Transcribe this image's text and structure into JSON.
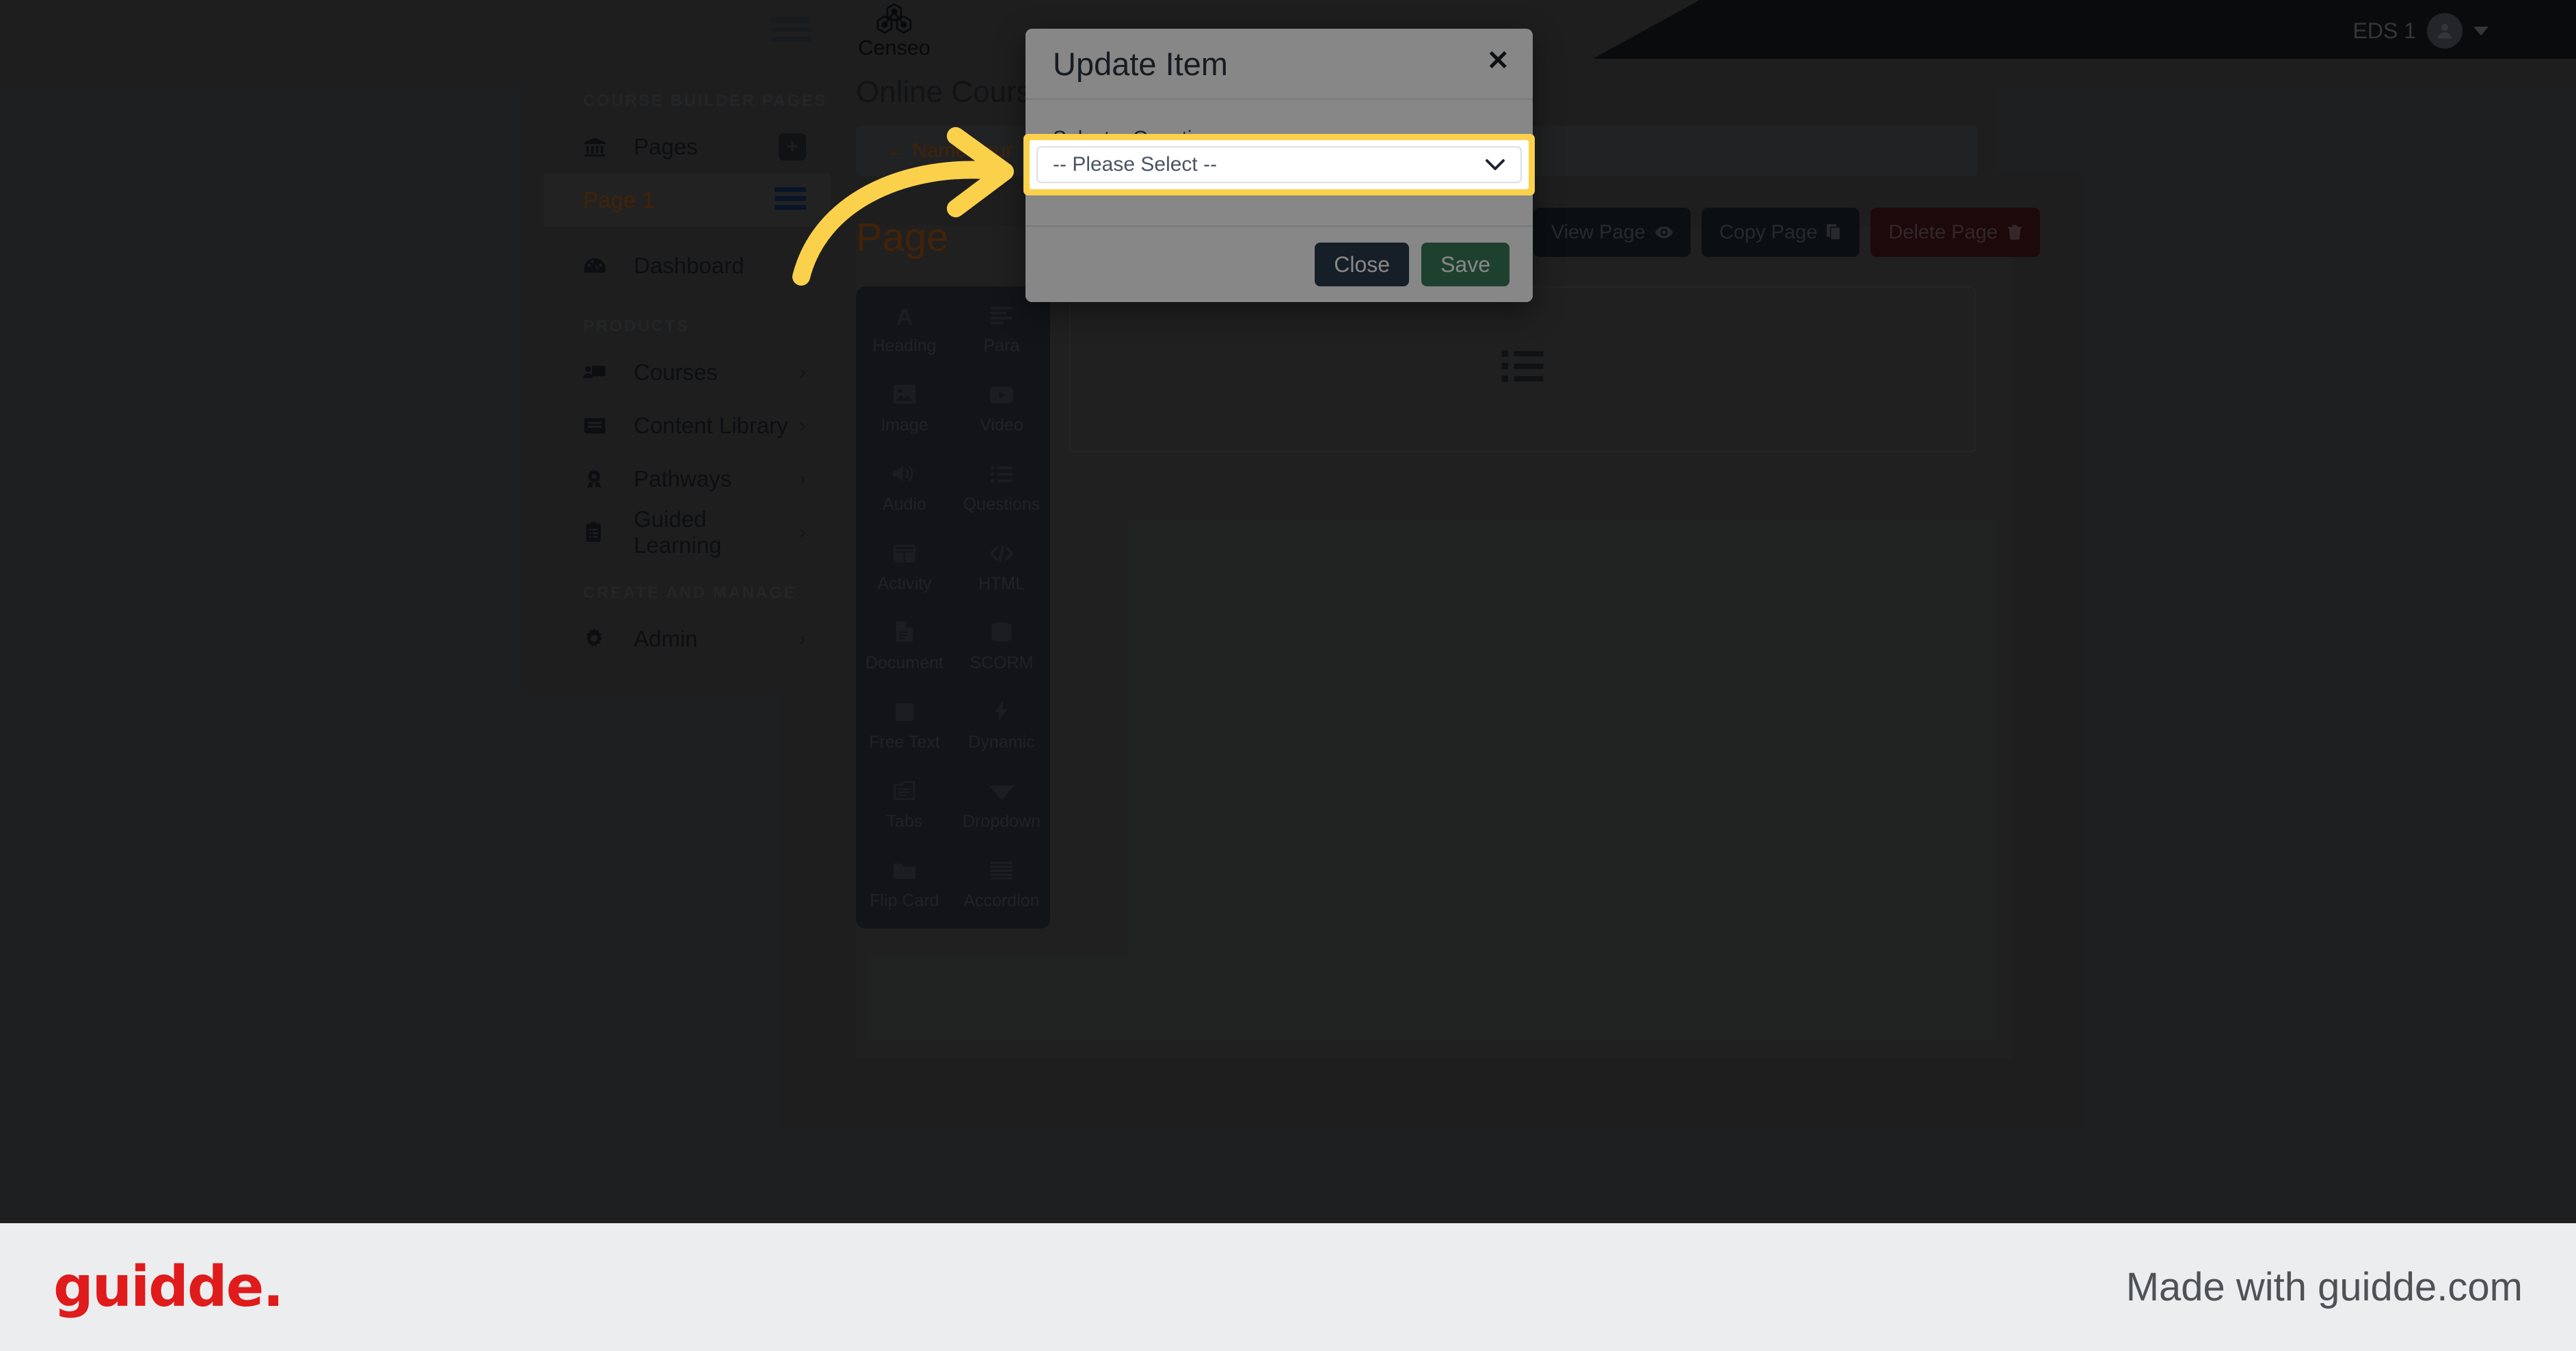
{
  "topbar": {
    "menu_icon": "hamburger-icon",
    "logo_text": "Censeo",
    "logo_icon": "censeo-hexagon-logo",
    "user_name": "EDS 1",
    "avatar_icon": "user-avatar-icon",
    "caret_icon": "caret-down-icon"
  },
  "sidebar": {
    "sections": [
      {
        "label": "COURSE BUILDER PAGES"
      },
      {
        "label": "PRODUCTS"
      },
      {
        "label": "CREATE AND MANAGE"
      }
    ],
    "pages_item": {
      "label": "Pages",
      "icon": "bank-icon",
      "add_icon": "plus-square-icon"
    },
    "page_item": {
      "label": "Page 1",
      "drag_icon": "drag-handle-icon"
    },
    "dashboard_item": {
      "label": "Dashboard",
      "icon": "speedometer-icon"
    },
    "products": [
      {
        "label": "Courses",
        "icon": "presentation-user-icon",
        "chevron": "chevron-right-icon"
      },
      {
        "label": "Content Library",
        "icon": "book-icon",
        "chevron": "chevron-right-icon"
      },
      {
        "label": "Pathways",
        "icon": "award-badge-icon",
        "chevron": "chevron-right-icon"
      },
      {
        "label": "Guided Learning",
        "icon": "clipboard-list-icon",
        "chevron": "chevron-right-icon"
      }
    ],
    "manage": [
      {
        "label": "Admin",
        "icon": "gear-icon",
        "chevron": "chevron-right-icon"
      }
    ]
  },
  "main": {
    "heading": "Online Course B",
    "name_hint": "← Name      your",
    "page_title": "Page",
    "actions": [
      {
        "label": "View Page",
        "icon": "eye-icon"
      },
      {
        "label": "Copy Page",
        "icon": "copy-icon"
      },
      {
        "label": "Delete Page",
        "icon": "trash-icon"
      }
    ],
    "drop_area_icon": "list-bullet-icon"
  },
  "tool_panel": {
    "items": [
      {
        "label": "Heading",
        "icon": "letter-a-icon"
      },
      {
        "label": "Para",
        "icon": "paragraph-lines-icon"
      },
      {
        "label": "Image",
        "icon": "image-icon"
      },
      {
        "label": "Video",
        "icon": "video-play-icon"
      },
      {
        "label": "Audio",
        "icon": "speaker-icon"
      },
      {
        "label": "Questions",
        "icon": "list-bullet-icon"
      },
      {
        "label": "Activity",
        "icon": "table-icon"
      },
      {
        "label": "HTML",
        "icon": "code-icon"
      },
      {
        "label": "Document",
        "icon": "file-icon"
      },
      {
        "label": "SCORM",
        "icon": "database-icon"
      },
      {
        "label": "Free Text",
        "icon": "square-icon"
      },
      {
        "label": "Dynamic",
        "icon": "lightning-icon"
      },
      {
        "label": "Tabs",
        "icon": "tabs-document-icon"
      },
      {
        "label": "Dropdown",
        "icon": "triangle-down-icon"
      },
      {
        "label": "Flip Card",
        "icon": "folder-icon"
      },
      {
        "label": "Accordion",
        "icon": "accordion-lines-icon"
      }
    ]
  },
  "modal": {
    "title": "Update Item",
    "close_icon": "close-x-icon",
    "select_label": "Select a Question:",
    "select_value": "-- Please Select --",
    "select_caret_icon": "chevron-down-icon",
    "close_button": "Close",
    "save_button": "Save"
  },
  "annotations": {
    "arrow_icon": "curved-arrow-icon",
    "highlight_color": "#FBD14B"
  },
  "footer": {
    "logo": "guidde.",
    "made_with": "Made with guidde.com"
  }
}
